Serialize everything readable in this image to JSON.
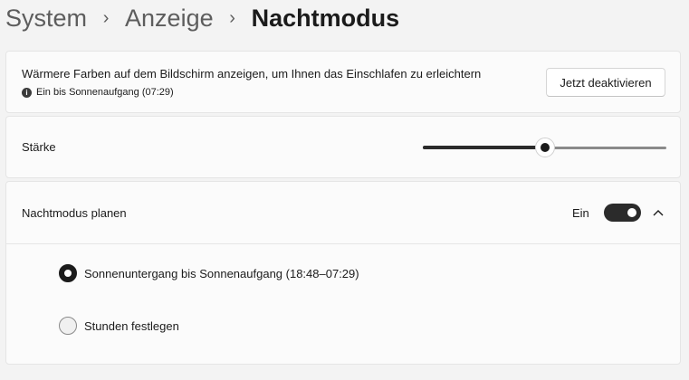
{
  "breadcrumb": {
    "items": [
      "System",
      "Anzeige"
    ],
    "current": "Nachtmodus"
  },
  "description_card": {
    "text": "Wärmere Farben auf dem Bildschirm anzeigen, um Ihnen das Einschlafen zu erleichtern",
    "status": "Ein bis Sonnenaufgang (07:29)",
    "status_icon": "info-icon",
    "button_label": "Jetzt deaktivieren"
  },
  "strength": {
    "label": "Stärke",
    "value_fraction": 0.5
  },
  "schedule": {
    "label": "Nachtmodus planen",
    "toggle_state_label": "Ein",
    "toggle_on": true,
    "expanded": true,
    "options": [
      {
        "label": "Sonnenuntergang bis Sonnenaufgang (18:48–07:29)",
        "checked": true
      },
      {
        "label": "Stunden festlegen",
        "checked": false
      }
    ]
  },
  "colors": {
    "background": "#f3f3f3",
    "card": "#fbfbfb",
    "accent": "#1b1b1b"
  }
}
